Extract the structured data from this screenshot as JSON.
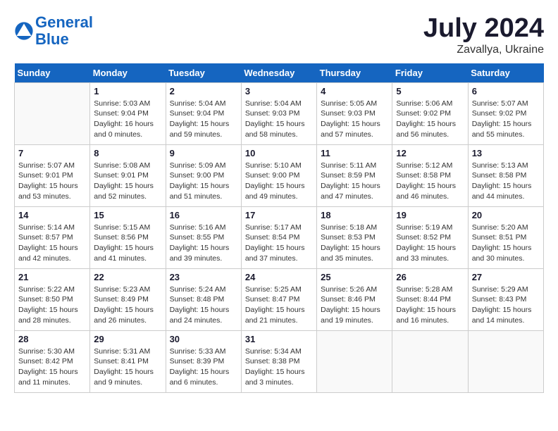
{
  "header": {
    "logo_line1": "General",
    "logo_line2": "Blue",
    "month": "July 2024",
    "location": "Zavallya, Ukraine"
  },
  "days_of_week": [
    "Sunday",
    "Monday",
    "Tuesday",
    "Wednesday",
    "Thursday",
    "Friday",
    "Saturday"
  ],
  "weeks": [
    [
      {
        "num": "",
        "empty": true
      },
      {
        "num": "1",
        "sunrise": "Sunrise: 5:03 AM",
        "sunset": "Sunset: 9:04 PM",
        "daylight": "Daylight: 16 hours and 0 minutes."
      },
      {
        "num": "2",
        "sunrise": "Sunrise: 5:04 AM",
        "sunset": "Sunset: 9:04 PM",
        "daylight": "Daylight: 15 hours and 59 minutes."
      },
      {
        "num": "3",
        "sunrise": "Sunrise: 5:04 AM",
        "sunset": "Sunset: 9:03 PM",
        "daylight": "Daylight: 15 hours and 58 minutes."
      },
      {
        "num": "4",
        "sunrise": "Sunrise: 5:05 AM",
        "sunset": "Sunset: 9:03 PM",
        "daylight": "Daylight: 15 hours and 57 minutes."
      },
      {
        "num": "5",
        "sunrise": "Sunrise: 5:06 AM",
        "sunset": "Sunset: 9:02 PM",
        "daylight": "Daylight: 15 hours and 56 minutes."
      },
      {
        "num": "6",
        "sunrise": "Sunrise: 5:07 AM",
        "sunset": "Sunset: 9:02 PM",
        "daylight": "Daylight: 15 hours and 55 minutes."
      }
    ],
    [
      {
        "num": "7",
        "sunrise": "Sunrise: 5:07 AM",
        "sunset": "Sunset: 9:01 PM",
        "daylight": "Daylight: 15 hours and 53 minutes."
      },
      {
        "num": "8",
        "sunrise": "Sunrise: 5:08 AM",
        "sunset": "Sunset: 9:01 PM",
        "daylight": "Daylight: 15 hours and 52 minutes."
      },
      {
        "num": "9",
        "sunrise": "Sunrise: 5:09 AM",
        "sunset": "Sunset: 9:00 PM",
        "daylight": "Daylight: 15 hours and 51 minutes."
      },
      {
        "num": "10",
        "sunrise": "Sunrise: 5:10 AM",
        "sunset": "Sunset: 9:00 PM",
        "daylight": "Daylight: 15 hours and 49 minutes."
      },
      {
        "num": "11",
        "sunrise": "Sunrise: 5:11 AM",
        "sunset": "Sunset: 8:59 PM",
        "daylight": "Daylight: 15 hours and 47 minutes."
      },
      {
        "num": "12",
        "sunrise": "Sunrise: 5:12 AM",
        "sunset": "Sunset: 8:58 PM",
        "daylight": "Daylight: 15 hours and 46 minutes."
      },
      {
        "num": "13",
        "sunrise": "Sunrise: 5:13 AM",
        "sunset": "Sunset: 8:58 PM",
        "daylight": "Daylight: 15 hours and 44 minutes."
      }
    ],
    [
      {
        "num": "14",
        "sunrise": "Sunrise: 5:14 AM",
        "sunset": "Sunset: 8:57 PM",
        "daylight": "Daylight: 15 hours and 42 minutes."
      },
      {
        "num": "15",
        "sunrise": "Sunrise: 5:15 AM",
        "sunset": "Sunset: 8:56 PM",
        "daylight": "Daylight: 15 hours and 41 minutes."
      },
      {
        "num": "16",
        "sunrise": "Sunrise: 5:16 AM",
        "sunset": "Sunset: 8:55 PM",
        "daylight": "Daylight: 15 hours and 39 minutes."
      },
      {
        "num": "17",
        "sunrise": "Sunrise: 5:17 AM",
        "sunset": "Sunset: 8:54 PM",
        "daylight": "Daylight: 15 hours and 37 minutes."
      },
      {
        "num": "18",
        "sunrise": "Sunrise: 5:18 AM",
        "sunset": "Sunset: 8:53 PM",
        "daylight": "Daylight: 15 hours and 35 minutes."
      },
      {
        "num": "19",
        "sunrise": "Sunrise: 5:19 AM",
        "sunset": "Sunset: 8:52 PM",
        "daylight": "Daylight: 15 hours and 33 minutes."
      },
      {
        "num": "20",
        "sunrise": "Sunrise: 5:20 AM",
        "sunset": "Sunset: 8:51 PM",
        "daylight": "Daylight: 15 hours and 30 minutes."
      }
    ],
    [
      {
        "num": "21",
        "sunrise": "Sunrise: 5:22 AM",
        "sunset": "Sunset: 8:50 PM",
        "daylight": "Daylight: 15 hours and 28 minutes."
      },
      {
        "num": "22",
        "sunrise": "Sunrise: 5:23 AM",
        "sunset": "Sunset: 8:49 PM",
        "daylight": "Daylight: 15 hours and 26 minutes."
      },
      {
        "num": "23",
        "sunrise": "Sunrise: 5:24 AM",
        "sunset": "Sunset: 8:48 PM",
        "daylight": "Daylight: 15 hours and 24 minutes."
      },
      {
        "num": "24",
        "sunrise": "Sunrise: 5:25 AM",
        "sunset": "Sunset: 8:47 PM",
        "daylight": "Daylight: 15 hours and 21 minutes."
      },
      {
        "num": "25",
        "sunrise": "Sunrise: 5:26 AM",
        "sunset": "Sunset: 8:46 PM",
        "daylight": "Daylight: 15 hours and 19 minutes."
      },
      {
        "num": "26",
        "sunrise": "Sunrise: 5:28 AM",
        "sunset": "Sunset: 8:44 PM",
        "daylight": "Daylight: 15 hours and 16 minutes."
      },
      {
        "num": "27",
        "sunrise": "Sunrise: 5:29 AM",
        "sunset": "Sunset: 8:43 PM",
        "daylight": "Daylight: 15 hours and 14 minutes."
      }
    ],
    [
      {
        "num": "28",
        "sunrise": "Sunrise: 5:30 AM",
        "sunset": "Sunset: 8:42 PM",
        "daylight": "Daylight: 15 hours and 11 minutes."
      },
      {
        "num": "29",
        "sunrise": "Sunrise: 5:31 AM",
        "sunset": "Sunset: 8:41 PM",
        "daylight": "Daylight: 15 hours and 9 minutes."
      },
      {
        "num": "30",
        "sunrise": "Sunrise: 5:33 AM",
        "sunset": "Sunset: 8:39 PM",
        "daylight": "Daylight: 15 hours and 6 minutes."
      },
      {
        "num": "31",
        "sunrise": "Sunrise: 5:34 AM",
        "sunset": "Sunset: 8:38 PM",
        "daylight": "Daylight: 15 hours and 3 minutes."
      },
      {
        "num": "",
        "empty": true
      },
      {
        "num": "",
        "empty": true
      },
      {
        "num": "",
        "empty": true
      }
    ]
  ]
}
